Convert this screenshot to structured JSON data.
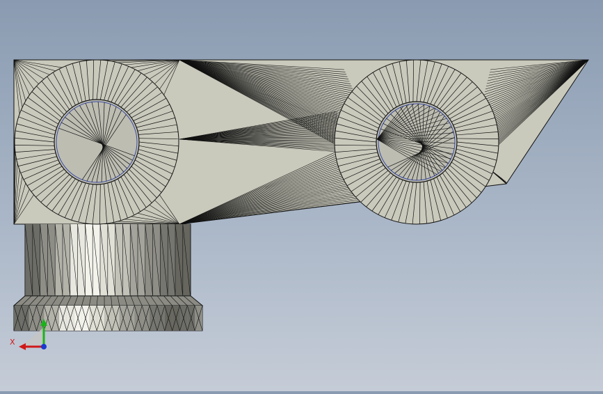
{
  "viewport": {
    "model": "bracket-part",
    "render_style": "shaded-with-edges",
    "colors": {
      "background_top": "#8a9bb1",
      "background_bottom": "#c5ccd7",
      "face": "#c9c9bc",
      "edge": "#111111"
    }
  },
  "triad": {
    "x_label": "X",
    "x_color": "#d01818",
    "y_color": "#19b419",
    "z_color": "#1a3ad0"
  }
}
